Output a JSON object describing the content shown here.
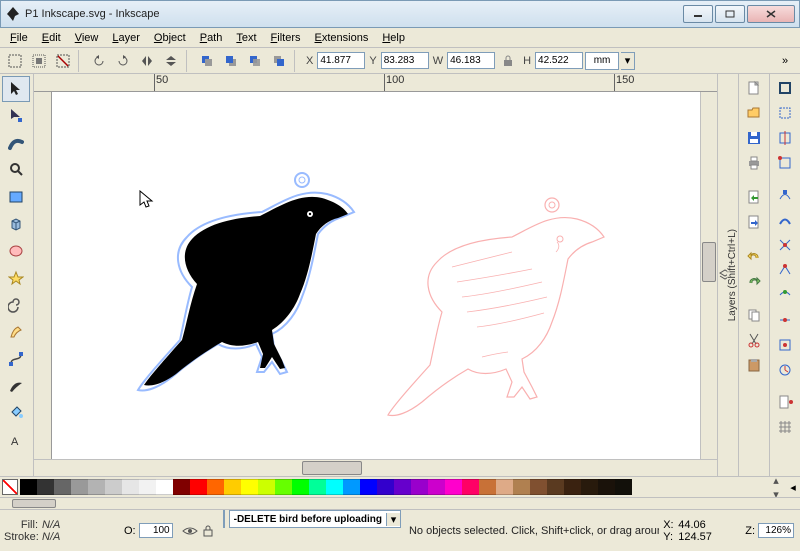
{
  "window": {
    "title": "P1 Inkscape.svg - Inkscape"
  },
  "menu": [
    "File",
    "Edit",
    "View",
    "Layer",
    "Object",
    "Path",
    "Text",
    "Filters",
    "Extensions",
    "Help"
  ],
  "toolbar": {
    "x_label": "X",
    "x": "41.877",
    "y_label": "Y",
    "y": "83.283",
    "w_label": "W",
    "w": "46.183",
    "h_label": "H",
    "h": "42.522",
    "unit": "mm"
  },
  "ruler": {
    "ticks": [
      "50",
      "100",
      "150"
    ]
  },
  "side_label": "Layers (Shift+Ctrl+L)",
  "palette": [
    "#000000",
    "#333333",
    "#666666",
    "#999999",
    "#b3b3b3",
    "#cccccc",
    "#e6e6e6",
    "#f2f2f2",
    "#ffffff",
    "#800000",
    "#ff0000",
    "#ff6600",
    "#ffcc00",
    "#ffff00",
    "#ccff00",
    "#66ff00",
    "#00ff00",
    "#00ff99",
    "#00ffff",
    "#0099ff",
    "#0000ff",
    "#3300cc",
    "#6600cc",
    "#9900cc",
    "#cc00cc",
    "#ff00cc",
    "#ff0066",
    "#c87137",
    "#deaa87",
    "#b08050",
    "#805030",
    "#5a3a20",
    "#3a2210",
    "#281a0c",
    "#1a120a",
    "#12100a"
  ],
  "status": {
    "fill_label": "Fill:",
    "fill_val": "N/A",
    "stroke_label": "Stroke:",
    "stroke_val": "N/A",
    "opacity_label": "O:",
    "opacity": "100",
    "layer_sel": "-DELETE bird before uploading",
    "hint": "No objects selected. Click, Shift+click, or drag around objects to select.",
    "x_label": "X:",
    "x": "44.06",
    "y_label": "Y:",
    "y": "124.57",
    "zoom_label": "Z:",
    "zoom": "126%"
  }
}
